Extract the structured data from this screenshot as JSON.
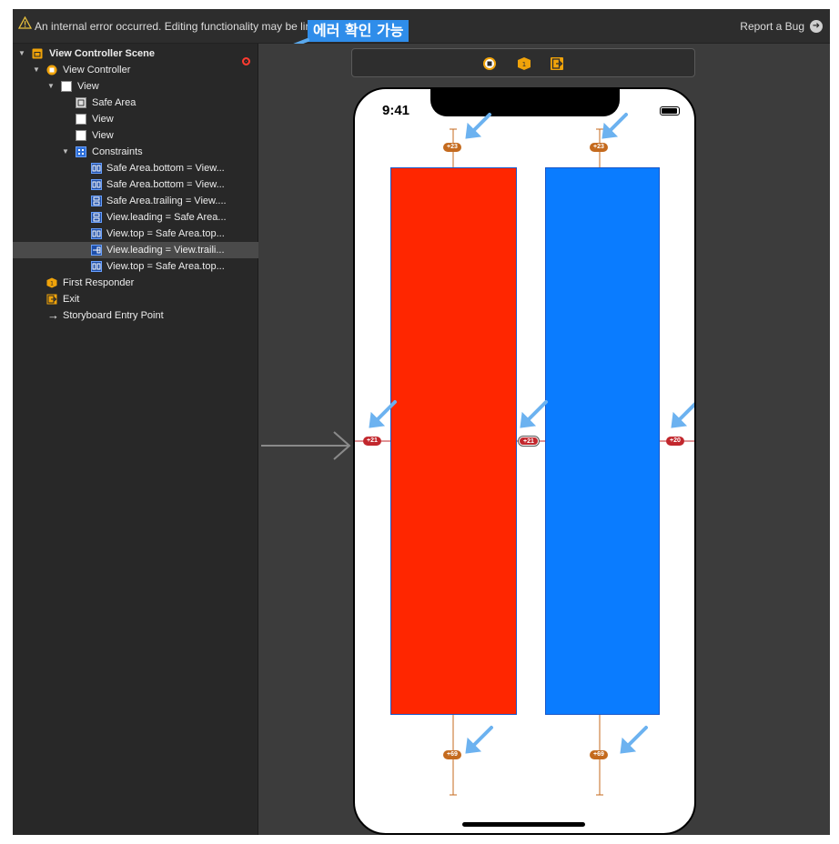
{
  "warning": {
    "text": "An internal error occurred. Editing functionality may be lir",
    "report_label": "Report a Bug"
  },
  "annotation": {
    "text": "에러 확인 가능"
  },
  "outline": {
    "scene": "View Controller Scene",
    "view_controller": "View Controller",
    "view": "View",
    "safe_area": "Safe Area",
    "child_views": [
      "View",
      "View"
    ],
    "constraints_label": "Constraints",
    "constraints": [
      "Safe Area.bottom = View...",
      "Safe Area.bottom = View...",
      "Safe Area.trailing = View....",
      "View.leading = Safe Area...",
      "View.top = Safe Area.top...",
      "View.leading = View.traili...",
      "View.top = Safe Area.top..."
    ],
    "selected_constraint_index": 5,
    "first_responder": "First Responder",
    "exit": "Exit",
    "entry_point": "Storyboard Entry Point"
  },
  "device": {
    "time": "9:41"
  },
  "constraint_badges": {
    "top_left": "+23",
    "top_right": "+23",
    "leading": "+21",
    "between": "+21",
    "trailing": "+20",
    "bottom_left": "+69",
    "bottom_right": "+69"
  },
  "colors": {
    "red_view": "#ff2600",
    "blue_view": "#0a7cff",
    "annotation": "#2f8dea",
    "constraint_orange": "#c46a1e",
    "constraint_red": "#c2272d"
  }
}
